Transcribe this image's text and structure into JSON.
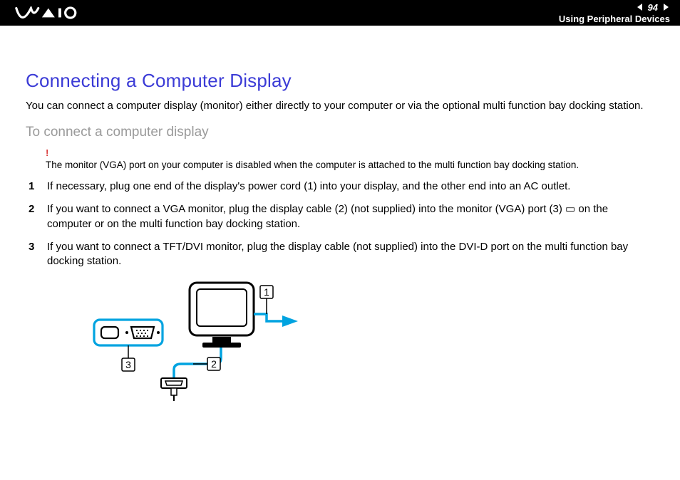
{
  "header": {
    "page_number": "94",
    "section": "Using Peripheral Devices"
  },
  "title": "Connecting a Computer Display",
  "intro": "You can connect a computer display (monitor) either directly to your computer or via the optional multi function bay docking station.",
  "subtitle": "To connect a computer display",
  "warning": {
    "bang": "!",
    "text": "The monitor (VGA) port on your computer is disabled when the computer is attached to the multi function bay docking station."
  },
  "steps": [
    "If necessary, plug one end of the display's power cord (1) into your display, and the other end into an AC outlet.",
    "If you want to connect a VGA monitor, plug the display cable (2) (not supplied) into the monitor (VGA) port (3) ▭ on the computer or on the multi function bay docking station.",
    "If you want to connect a TFT/DVI monitor, plug the display cable (not supplied) into the DVI-D port on the multi function bay docking station."
  ],
  "figure": {
    "callouts": [
      "1",
      "2",
      "3"
    ]
  }
}
